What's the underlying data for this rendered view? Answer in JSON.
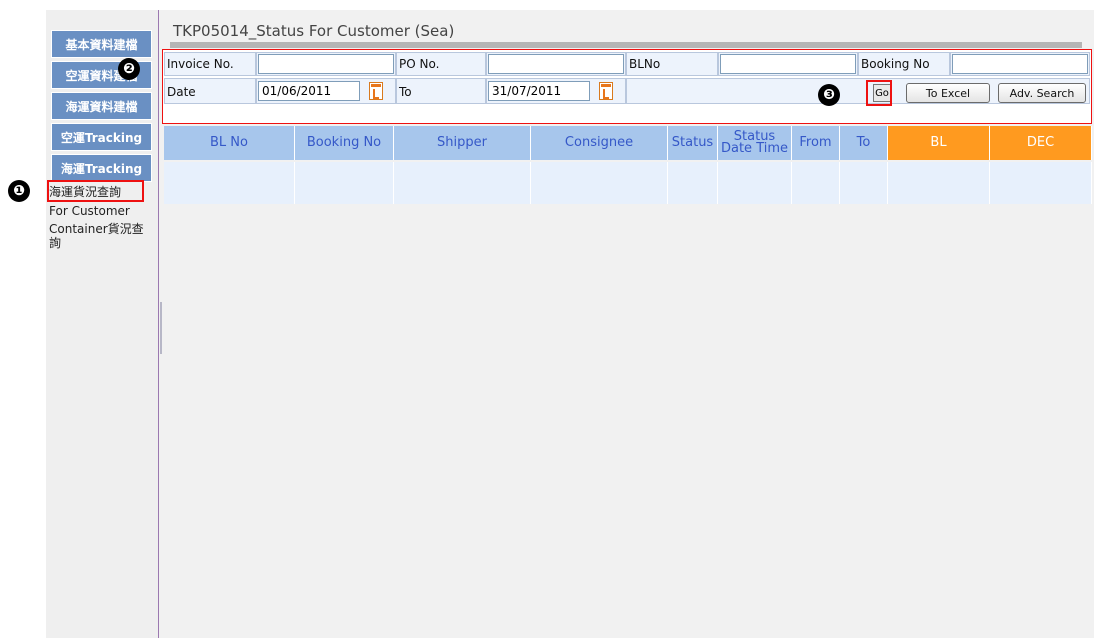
{
  "page": {
    "title": "TKP05014_Status For Customer (Sea)"
  },
  "sidebar": {
    "buttons": [
      "基本資料建檔",
      "空運資料建檔",
      "海運資料建檔",
      "空運Tracking",
      "海運Tracking"
    ],
    "links": [
      "海運貨況查詢",
      "For Customer",
      "Container貨況查",
      "詢"
    ]
  },
  "badges": {
    "one": "❶",
    "two": "❷",
    "three": "❸"
  },
  "form": {
    "invoice_label": "Invoice No.",
    "po_label": "PO No.",
    "blno_label": "BLNo",
    "booking_label": "Booking No",
    "date_label": "Date",
    "to_label": "To",
    "date_from": "01/06/2011",
    "date_to": "31/07/2011",
    "go_label": "Go",
    "to_excel_label": "To Excel",
    "adv_search_label": "Adv. Search"
  },
  "grid": {
    "columns": [
      "BL No",
      "Booking No",
      "Shipper",
      "Consignee",
      "Status",
      "Status Date Time",
      "From",
      "To",
      "BL",
      "DEC"
    ]
  },
  "colors": {
    "nav": "#6a90c3",
    "header": "#a7c6ec",
    "accent": "#ff9a1f",
    "highlight": "#ee1111"
  }
}
